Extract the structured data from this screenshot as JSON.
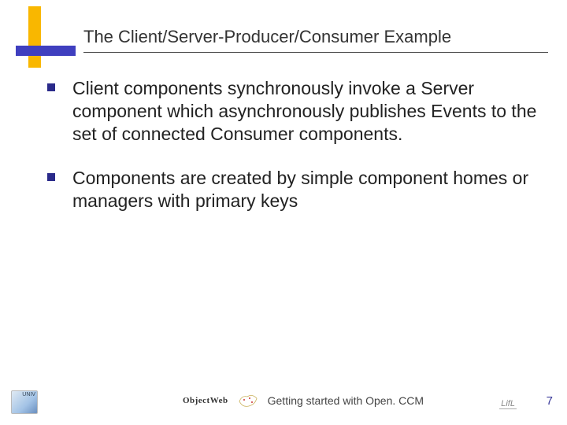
{
  "title": "The Client/Server-Producer/Consumer Example",
  "bullets": [
    "Client components synchronously invoke a Server component which asynchronously publishes Events to the set of connected Consumer components.",
    "Components are created by simple component homes or managers with primary keys"
  ],
  "footer": {
    "caption": "Getting started with Open. CCM",
    "page_number": "7",
    "objectweb": "ObjectWeb",
    "right_logo": "LifL",
    "corner_badge": "UNIV"
  }
}
